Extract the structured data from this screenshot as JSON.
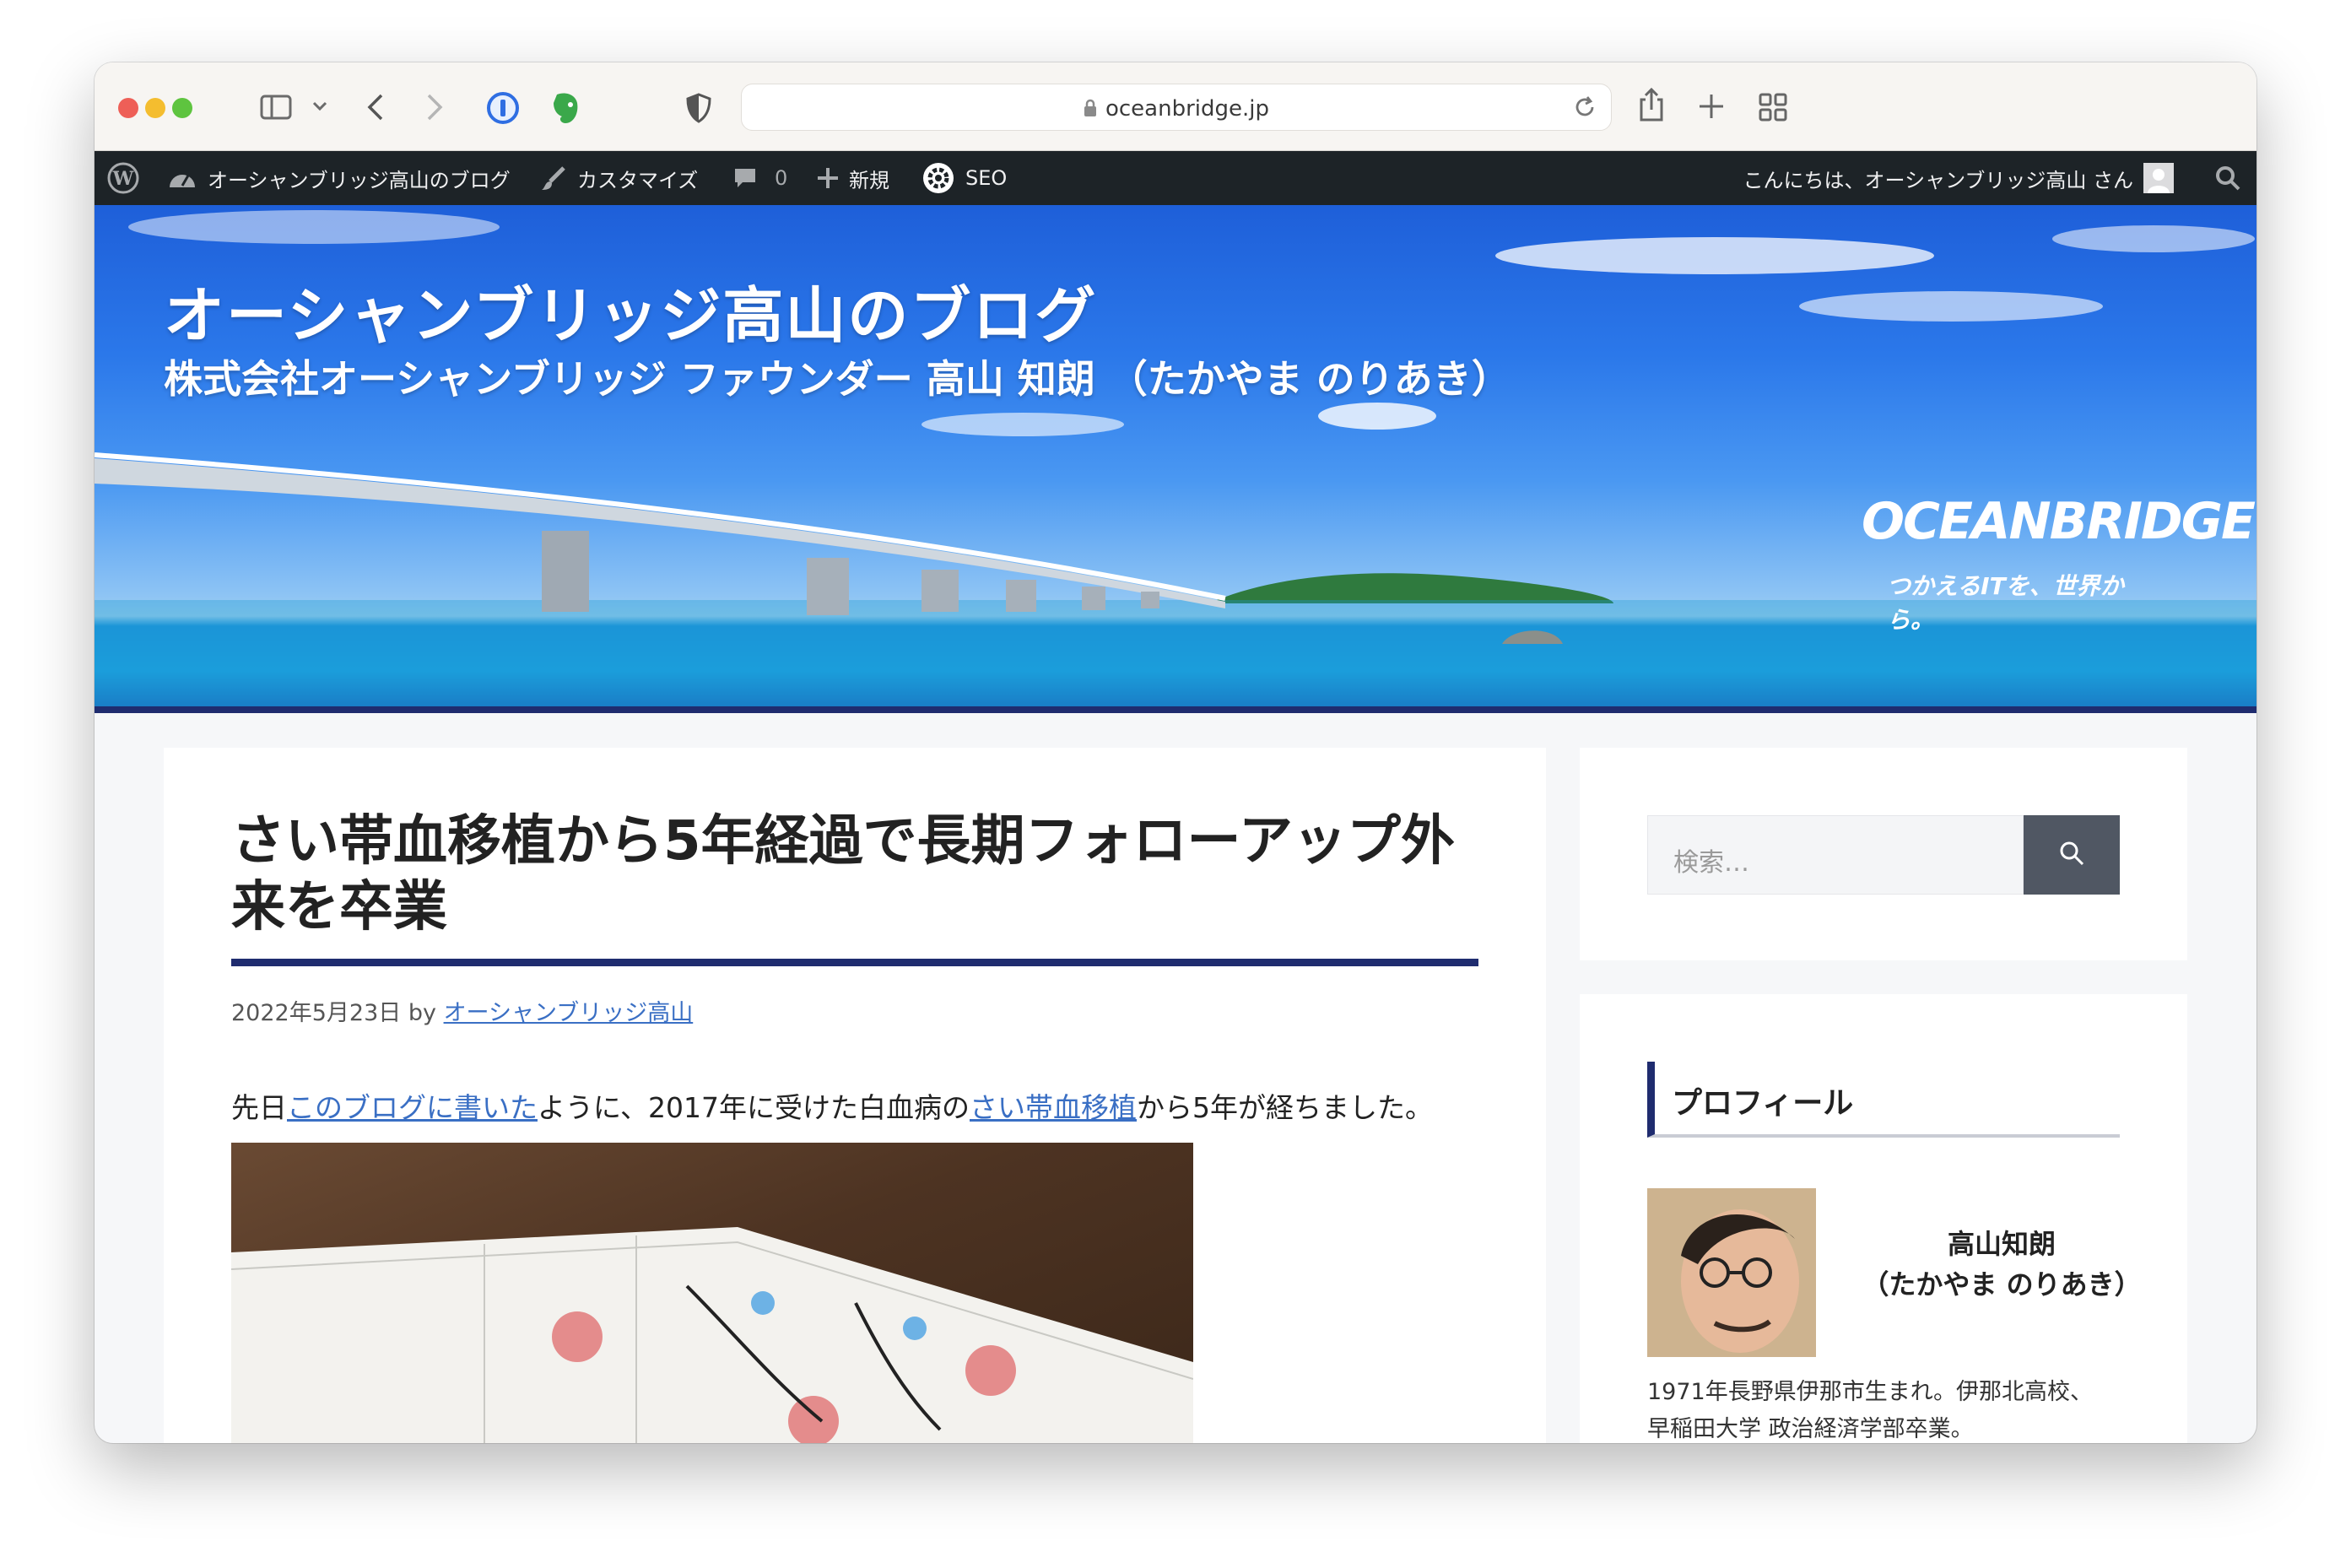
{
  "browser": {
    "url": "oceanbridge.jp"
  },
  "adminbar": {
    "site_name": "オーシャンブリッジ高山のブログ",
    "customize": "カスタマイズ",
    "comments_count": "0",
    "new": "新規",
    "seo": "SEO",
    "greeting": "こんにちは、オーシャンブリッジ高山 さん"
  },
  "header": {
    "title": "オーシャンブリッジ高山のブログ",
    "subtitle": "株式会社オーシャンブリッジ ファウンダー 高山 知朗 （たかやま のりあき）",
    "brand_name": "OCEANBRIDGE",
    "brand_tagline": "つかえるITを、世界から。"
  },
  "post": {
    "title": "さい帯血移植から5年経過で長期フォローアップ外来を卒業",
    "date": "2022年5月23日",
    "by": "by",
    "author": "オーシャンブリッジ高山",
    "lede_1": "先日",
    "lede_link_1": "このブログに書いた",
    "lede_2": "ように、2017年に受けた白血病の",
    "lede_link_2": "さい帯血移植",
    "lede_3": "から5年が経ちました。"
  },
  "sidebar": {
    "search_placeholder": "検索…",
    "profile_title": "プロフィール",
    "profile_name": "高山知朗",
    "profile_reading": "（たかやま のりあき）",
    "profile_bio_1": "1971年長野県伊那市生まれ。伊那北高校、",
    "profile_bio_2": "早稲田大学 政治経済学部卒業。"
  },
  "colors": {
    "accent_navy": "#1f2c6f",
    "link_blue": "#3a6fc4",
    "adminbar_bg": "#1d2327"
  }
}
